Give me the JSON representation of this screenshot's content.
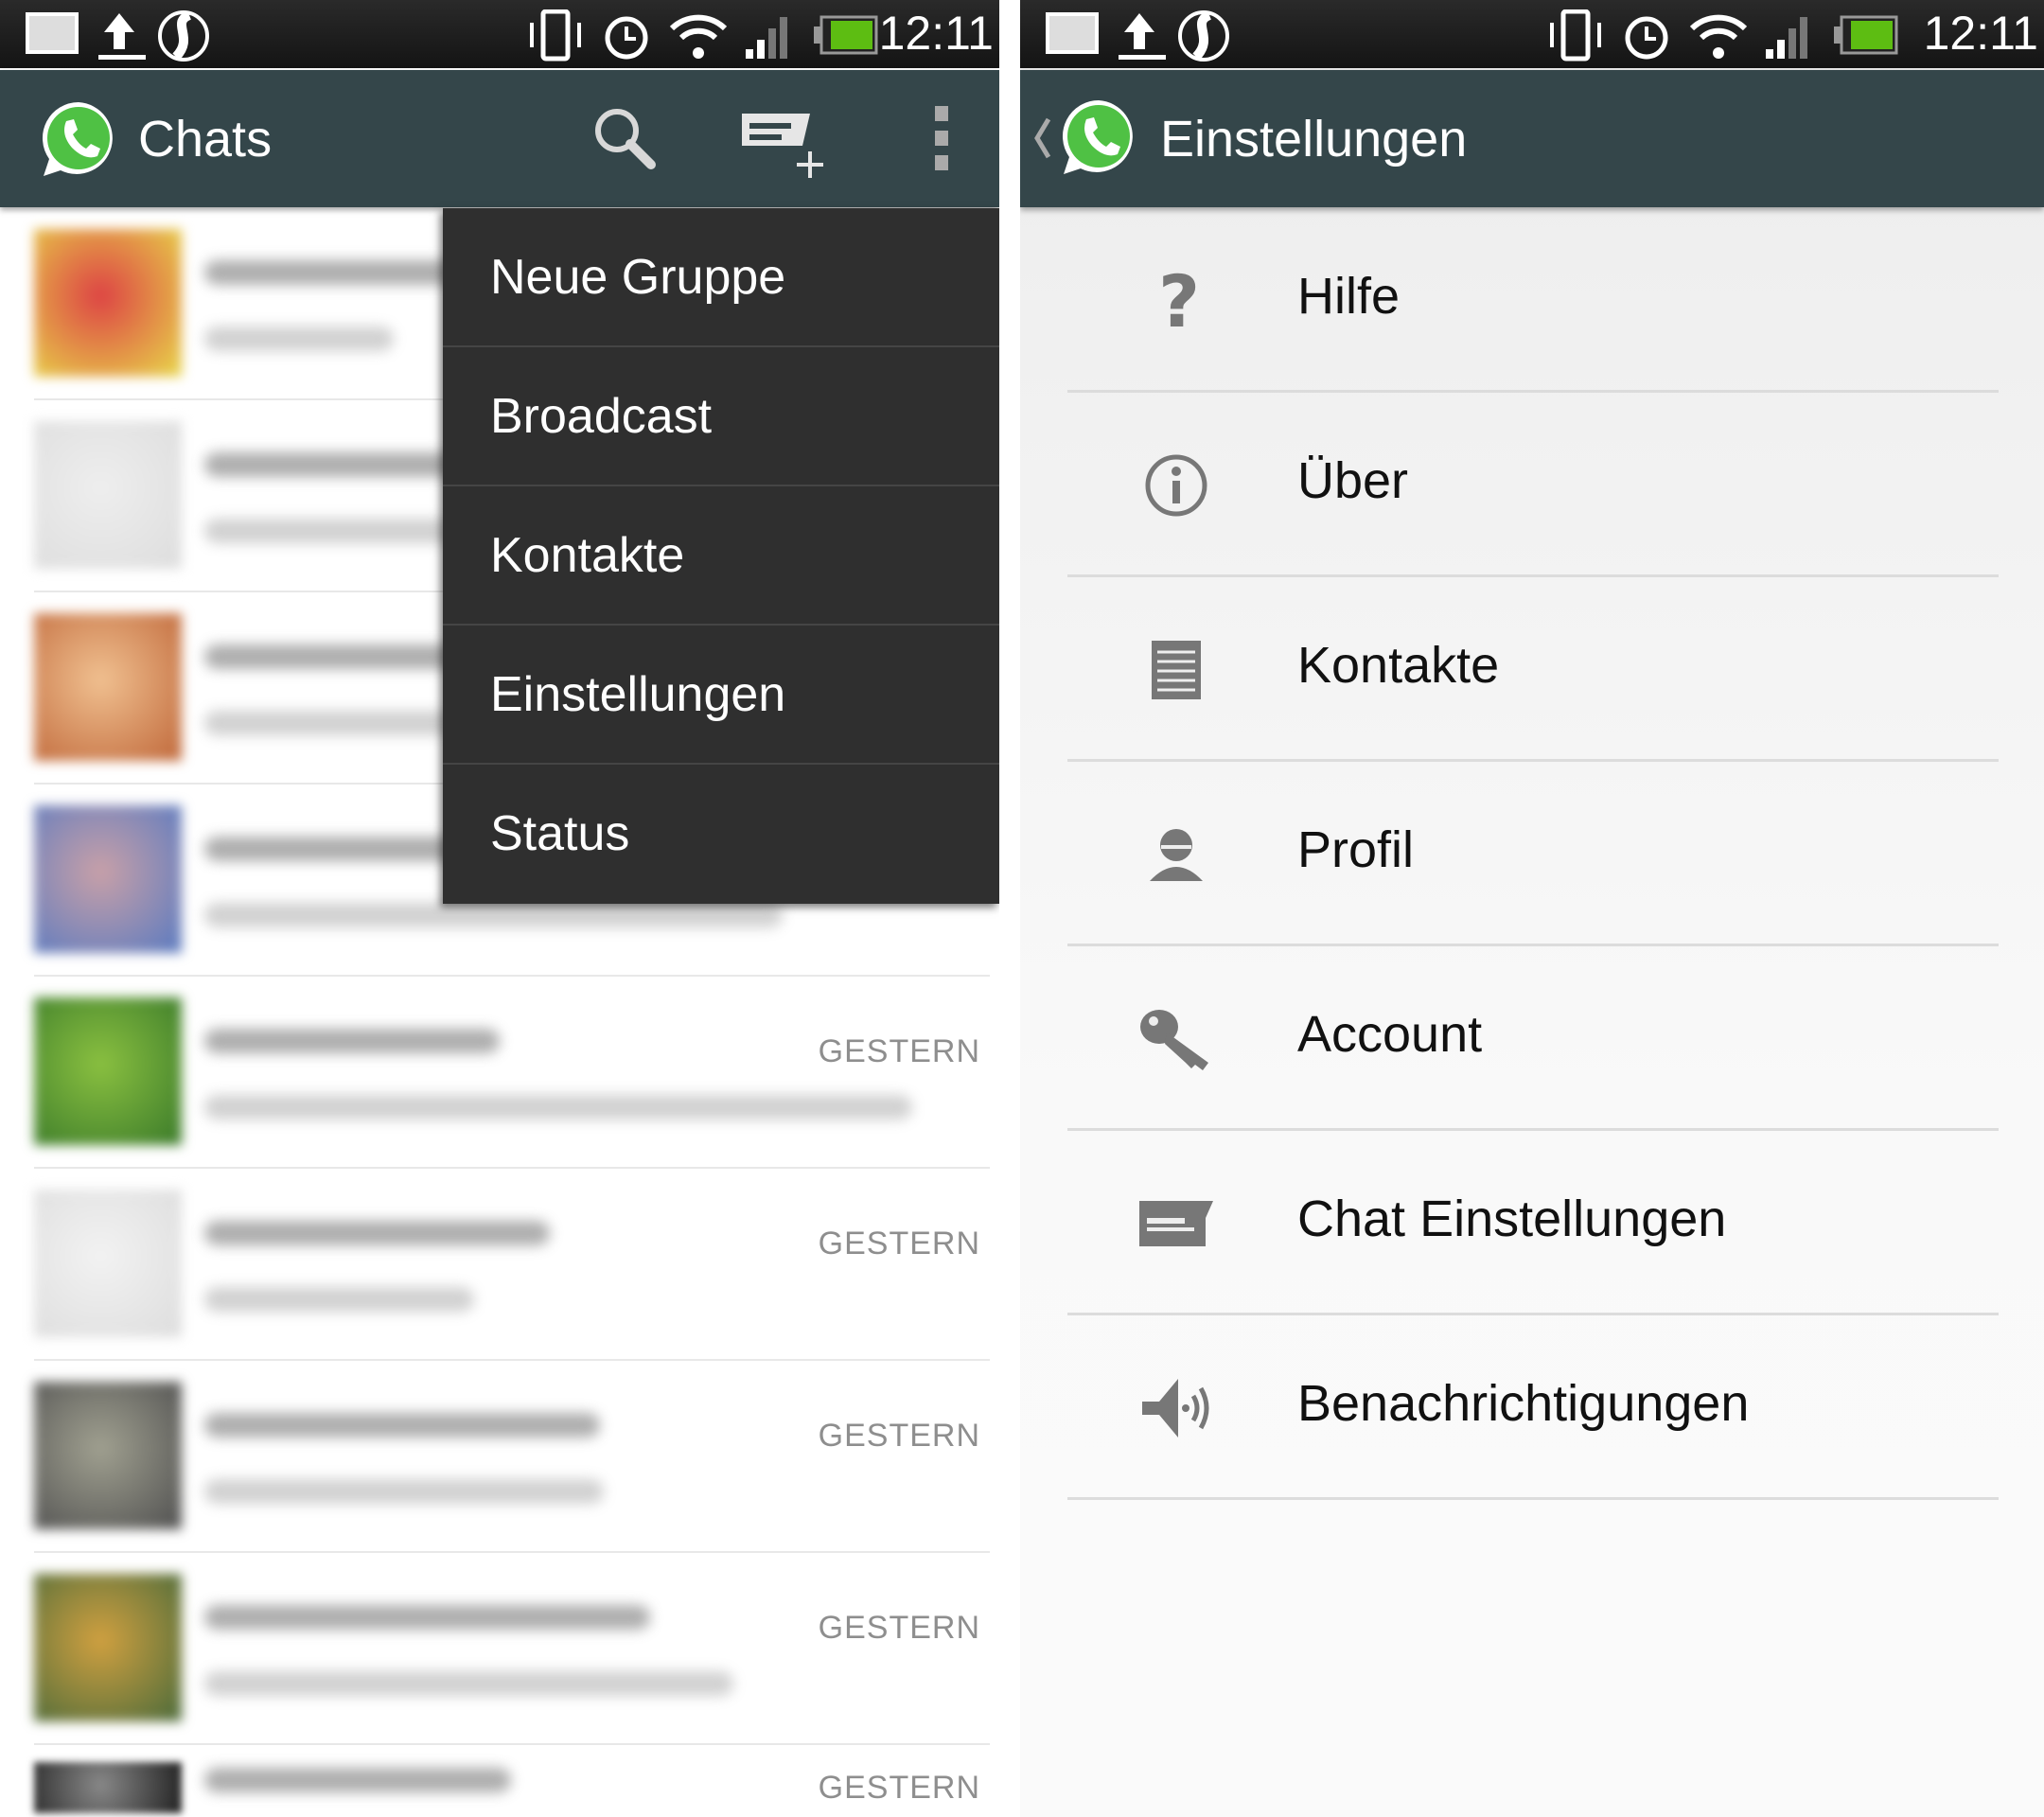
{
  "status_bar": {
    "time": "12:11",
    "icons": [
      "screenshot-icon",
      "upload-icon",
      "swiftkey-icon",
      "vibrate-icon",
      "alarm-icon",
      "wifi-icon",
      "signal-icon",
      "battery-icon"
    ]
  },
  "left": {
    "title": "Chats",
    "actions": [
      "search-icon",
      "new-chat-icon",
      "overflow-menu-icon"
    ],
    "menu": [
      "Neue Gruppe",
      "Broadcast",
      "Kontakte",
      "Einstellungen",
      "Status"
    ],
    "chats": [
      {
        "time": ""
      },
      {
        "time": ""
      },
      {
        "time": ""
      },
      {
        "time": ""
      },
      {
        "time": "GESTERN"
      },
      {
        "time": "GESTERN"
      },
      {
        "time": "GESTERN"
      },
      {
        "time": "GESTERN"
      },
      {
        "time": "GESTERN"
      }
    ]
  },
  "right": {
    "title": "Einstellungen",
    "items": [
      {
        "label": "Hilfe",
        "icon": "help-icon"
      },
      {
        "label": "Über",
        "icon": "info-icon"
      },
      {
        "label": "Kontakte",
        "icon": "contacts-icon"
      },
      {
        "label": "Profil",
        "icon": "profile-icon"
      },
      {
        "label": "Account",
        "icon": "key-icon"
      },
      {
        "label": "Chat Einstellungen",
        "icon": "chat-icon"
      },
      {
        "label": "Benachrichtigungen",
        "icon": "speaker-icon"
      }
    ]
  },
  "colors": {
    "actionbar": "#34464a",
    "whatsapp_green": "#4fc144",
    "menu_bg": "#2f2f2f"
  }
}
